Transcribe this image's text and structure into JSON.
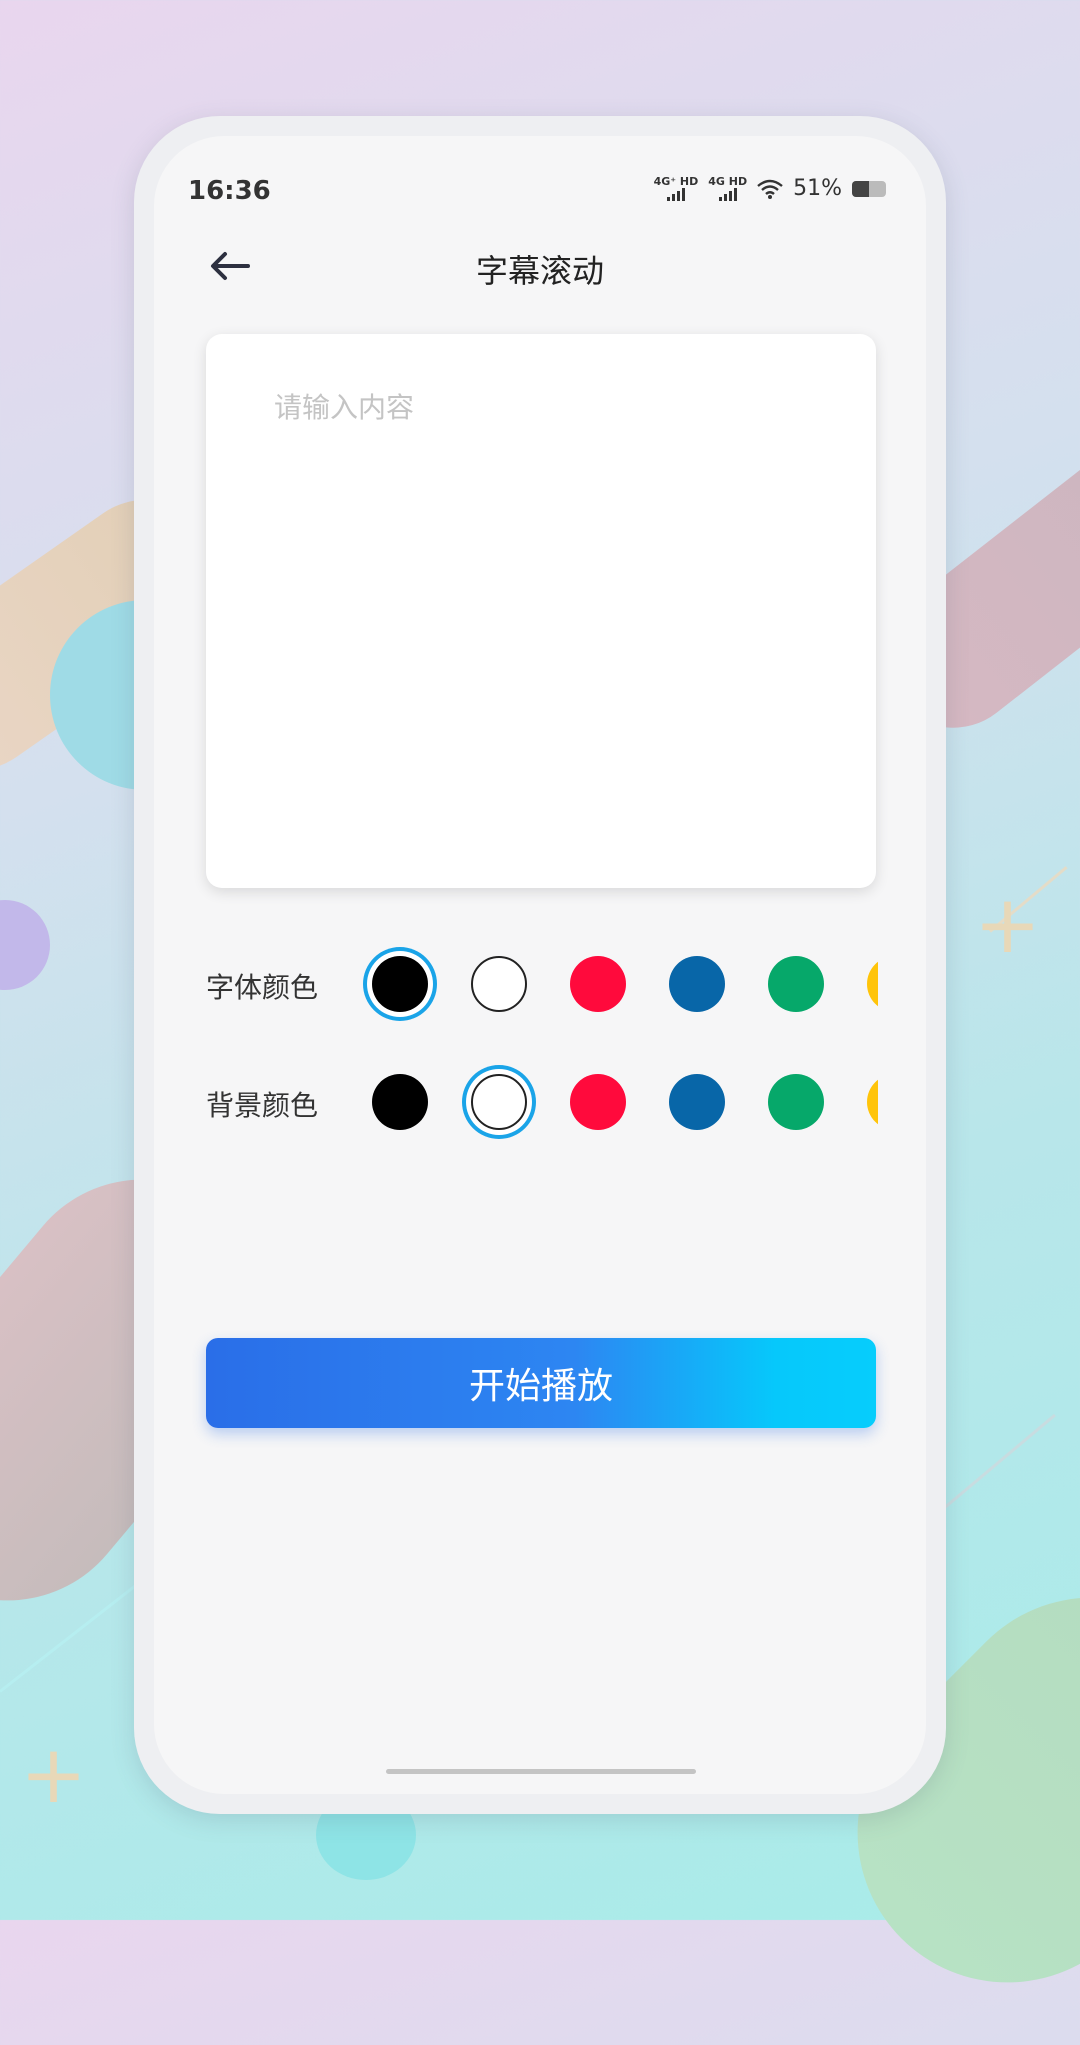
{
  "status_bar": {
    "time": "16:36",
    "network_1": "4G⁺ HD",
    "network_2": "4G HD",
    "battery_percent": "51%",
    "battery_level": 0.51,
    "icons": [
      "signal-icon",
      "signal-icon",
      "wifi-icon",
      "battery-icon"
    ]
  },
  "header": {
    "back_icon": "arrow-left-icon",
    "title": "字幕滚动"
  },
  "input": {
    "placeholder": "请输入内容",
    "value": ""
  },
  "font_color": {
    "label": "字体颜色",
    "selected_index": 0,
    "swatches": [
      "#000000",
      "#ffffff",
      "#ff0a3c",
      "#0866a8",
      "#06a86a",
      "#ffc40a"
    ]
  },
  "background_color": {
    "label": "背景颜色",
    "selected_index": 1,
    "swatches": [
      "#000000",
      "#ffffff",
      "#ff0a3c",
      "#0866a8",
      "#06a86a",
      "#ffc40a"
    ]
  },
  "actions": {
    "start_label": "开始播放",
    "accent_start": "#2a6ee8",
    "accent_end": "#06cdfc"
  }
}
